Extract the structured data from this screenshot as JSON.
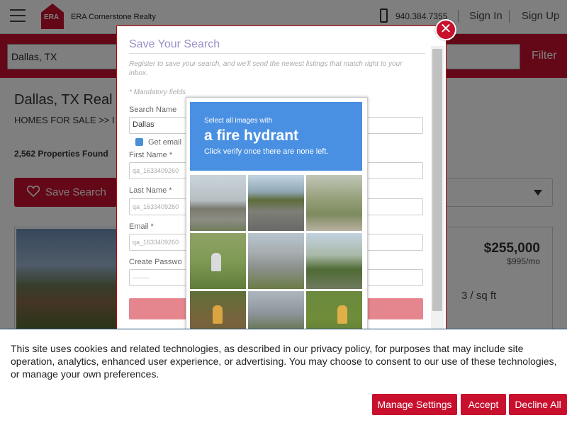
{
  "header": {
    "logo_text": "ERA",
    "brand": "ERA Cornerstone Realty",
    "phone": "940.384.7355",
    "sign_in": "Sign In",
    "sign_up": "Sign Up"
  },
  "search": {
    "value": "Dallas, TX",
    "filter_label": "Filter"
  },
  "page": {
    "title": "Dallas, TX Real",
    "breadcrumb": "HOMES FOR SALE  >> I",
    "count": "2,562 Properties Found",
    "save_search_label": "Save Search"
  },
  "listing": {
    "price": "$255,000",
    "rent": "$995/mo",
    "sqft": "3 / sq ft"
  },
  "modal": {
    "title": "Save Your Search",
    "description": "Register to save your search, and we'll send the newest listings that match right to your inbox.",
    "mandatory": "* Mandatory fields",
    "search_name_label": "Search Name",
    "search_name_value": "Dallas",
    "email_alert_label": "Get email",
    "first_name_label": "First Name *",
    "first_name_value": "qa_1633409260",
    "last_name_label": "Last Name *",
    "last_name_value": "qa_1633409260",
    "email_label": "Email *",
    "email_value": "qa_1633409260",
    "password_label": "Create Passwo",
    "password_value": "--------",
    "close_symbol": "✕"
  },
  "captcha": {
    "prompt_small": "Select all images with",
    "prompt_target": "a fire hydrant",
    "prompt_instruction": "Click verify once there are none left."
  },
  "cookie": {
    "text": "This site uses cookies and related technologies, as described in our privacy policy, for purposes that may include site operation, analytics, enhanced user experience, or advertising. You may choose to consent to our use of these technologies, or manage your own preferences.",
    "manage_label": "Manage Settings",
    "accept_label": "Accept",
    "decline_label": "Decline All"
  }
}
